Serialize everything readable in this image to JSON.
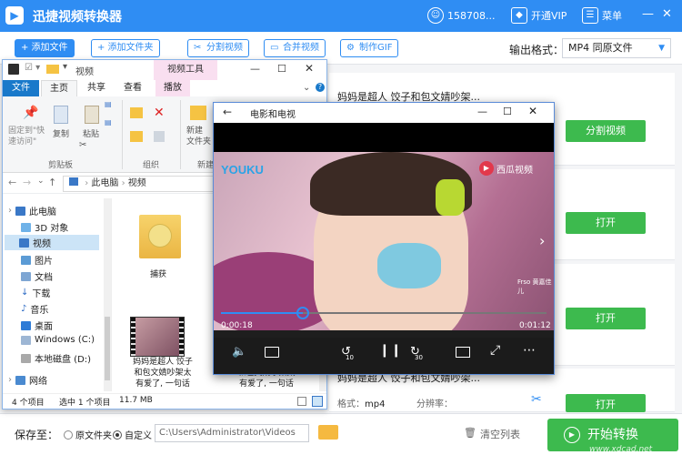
{
  "app": {
    "title": "迅捷视频转换器",
    "user_id": "158708...",
    "vip_label": "开通VIP",
    "menu_label": "菜单"
  },
  "toolbar": {
    "add_file": "+ 添加文件",
    "add_folder": "+ 添加文件夹",
    "split_video": "分割视频",
    "merge_video": "合并视频",
    "make_gif": "制作GIF",
    "output_format_label": "输出格式：",
    "output_format_value": "MP4  同原文件"
  },
  "list": {
    "item1_title": "妈妈是超人 饺子和包文婧吵架...",
    "item1_button": "分割视频",
    "item2_button": "打开",
    "item3_button": "打开",
    "item4_title": "妈妈是超人 饺子和包文婧吵架...",
    "format_label": "格式：",
    "format_value": "mp4",
    "resolution_label": "分辨率：",
    "item4_button": "打开"
  },
  "bottom": {
    "save_to": "保存至：",
    "opt_original": "原文件夹",
    "opt_custom": "自定义",
    "path": "C:\\Users\\Administrator\\Videos",
    "clear_list": "清空列表",
    "start_convert": "开始转换",
    "watermark": "www.xdcad.net"
  },
  "explorer": {
    "window_title": "视频",
    "ribbon_context": "视频工具",
    "tab_file": "文件",
    "tab_home": "主页",
    "tab_share": "共享",
    "tab_view": "查看",
    "tab_play": "播放",
    "ribbon": {
      "pin": "固定到\"快\n速访问\"",
      "copy": "复制",
      "paste": "粘贴",
      "clipboard_group": "剪贴板",
      "organize_group": "组织",
      "new_folder": "新建\n文件夹",
      "new_group": "新建"
    },
    "breadcrumb": [
      "此电脑",
      "视频"
    ],
    "nav": [
      "此电脑",
      "3D 对象",
      "视频",
      "图片",
      "文档",
      "下载",
      "音乐",
      "桌面",
      "Windows (C:)",
      "本地磁盘 (D:)",
      "网络"
    ],
    "files": [
      {
        "name": "捕获"
      },
      {
        "name": "妈妈是超人 饺子\n和包文婧吵架太\n有爱了, 一句话"
      },
      {
        "name": "和包文婧吵架太\n有爱了, 一句话"
      }
    ],
    "status": {
      "count": "4 个项目",
      "selected": "选中 1 个项目",
      "size": "11.7 MB"
    }
  },
  "player": {
    "title": "电影和电视",
    "logo_youku": "YOUKU",
    "logo_xigua": "西瓜视频",
    "time_current": "0:00:18",
    "time_total": "0:01:12",
    "progress": 0.25,
    "skip_back": "10",
    "skip_forward": "30",
    "video_watermark": "Frso 黄嘉佳儿"
  },
  "colors": {
    "brand_blue": "#2f8df3",
    "green": "#3dba4e",
    "explorer_blue": "#1979ca"
  }
}
